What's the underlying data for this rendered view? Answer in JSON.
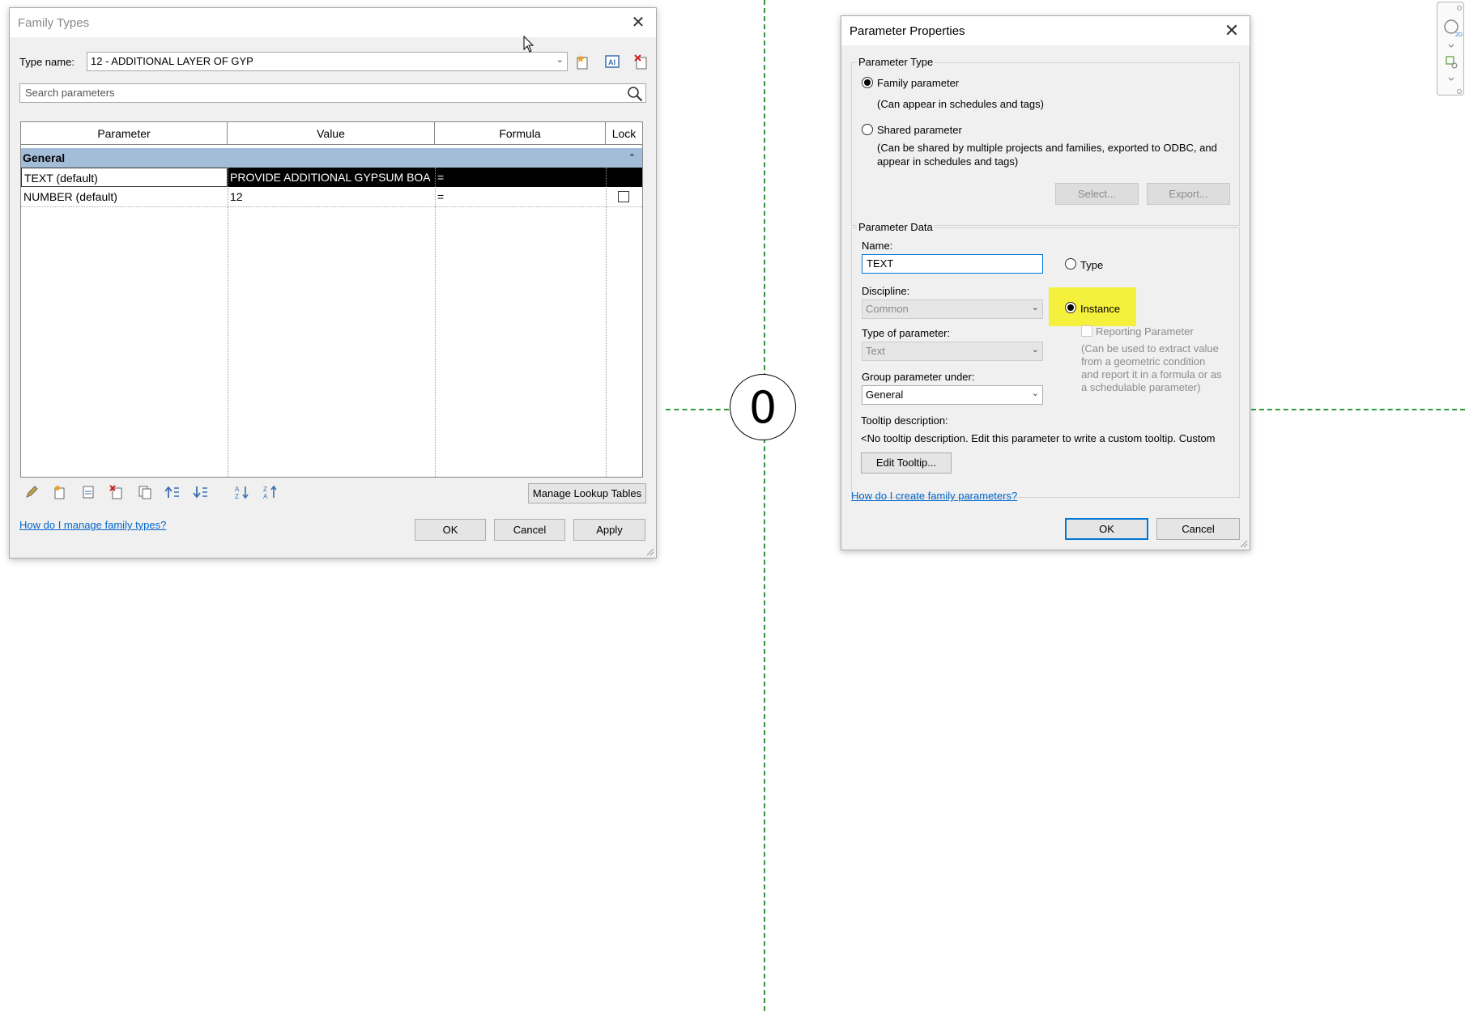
{
  "canvas": {
    "level_number": "0"
  },
  "family_types": {
    "title": "Family Types",
    "type_name_label": "Type name:",
    "type_name_value": "12 - ADDITIONAL LAYER OF GYP",
    "search_placeholder": "Search parameters",
    "columns": [
      "Parameter",
      "Value",
      "Formula",
      "Lock"
    ],
    "group_name": "General",
    "rows": [
      {
        "parameter": "TEXT (default)",
        "value": "PROVIDE ADDITIONAL GYPSUM BOA",
        "formula": "="
      },
      {
        "parameter": "NUMBER (default)",
        "value": "12",
        "formula": "="
      }
    ],
    "manage_lookup_label": "Manage Lookup Tables",
    "help_link": "How do I manage family types?",
    "ok_label": "OK",
    "cancel_label": "Cancel",
    "apply_label": "Apply"
  },
  "parameter_properties": {
    "title": "Parameter Properties",
    "parameter_type_group": "Parameter Type",
    "family_parameter_label": "Family parameter",
    "family_parameter_desc": "(Can appear in schedules and tags)",
    "shared_parameter_label": "Shared parameter",
    "shared_parameter_desc_1": "(Can be shared by multiple projects and families, exported to ODBC, and",
    "shared_parameter_desc_2": "appear in schedules and tags)",
    "select_label": "Select...",
    "export_label": "Export...",
    "parameter_data_group": "Parameter Data",
    "name_label": "Name:",
    "name_value": "TEXT",
    "type_radio_label": "Type",
    "instance_radio_label": "Instance",
    "discipline_label": "Discipline:",
    "discipline_value": "Common",
    "type_of_parameter_label": "Type of parameter:",
    "type_of_parameter_value": "Text",
    "reporting_parameter_label": "Reporting Parameter",
    "reporting_desc_1": "(Can be used to extract value",
    "reporting_desc_2": "from a geometric condition",
    "reporting_desc_3": "and report it in a formula or as",
    "reporting_desc_4": "a schedulable parameter)",
    "group_under_label": "Group parameter under:",
    "group_under_value": "General",
    "tooltip_label": "Tooltip description:",
    "tooltip_value": "<No tooltip description. Edit this parameter to write a custom tooltip. Custom",
    "edit_tooltip_label": "Edit Tooltip...",
    "help_link": "How do I create family parameters?",
    "ok_label": "OK",
    "cancel_label": "Cancel"
  },
  "colors": {
    "highlight": "#f5f03c",
    "group_row": "#a3bcd8",
    "reference_line": "#2e9a3c",
    "link": "#0066cc"
  }
}
